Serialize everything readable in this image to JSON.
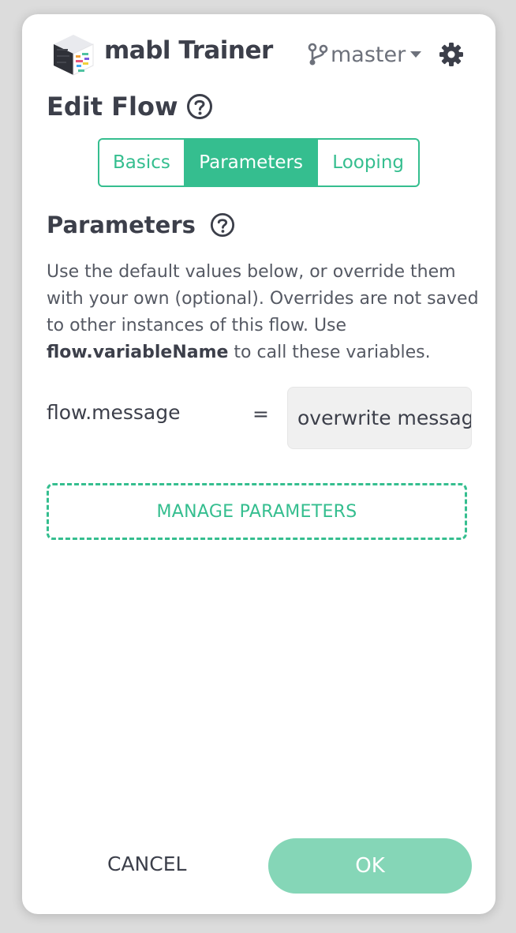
{
  "header": {
    "app_title": "mabl Trainer",
    "branch_name": "master"
  },
  "dialog": {
    "title": "Edit Flow"
  },
  "tabs": [
    {
      "label": "Basics",
      "active": false
    },
    {
      "label": "Parameters",
      "active": true
    },
    {
      "label": "Looping",
      "active": false
    }
  ],
  "parameters": {
    "title": "Parameters",
    "description_prefix": "Use the default values below, or override them with your own (optional). Overrides are not saved to other instances of this flow. Use ",
    "description_bold": "flow.variableName",
    "description_suffix": " to call these variables.",
    "rows": [
      {
        "name": "flow.message",
        "operator": "=",
        "value": "overwrite message"
      }
    ],
    "manage_label": "MANAGE PARAMETERS"
  },
  "footer": {
    "cancel_label": "CANCEL",
    "ok_label": "OK"
  },
  "colors": {
    "accent": "#35be8f",
    "ok_button": "#85d6b7",
    "text": "#3c3f4a",
    "input_background": "#f0f0f0"
  }
}
